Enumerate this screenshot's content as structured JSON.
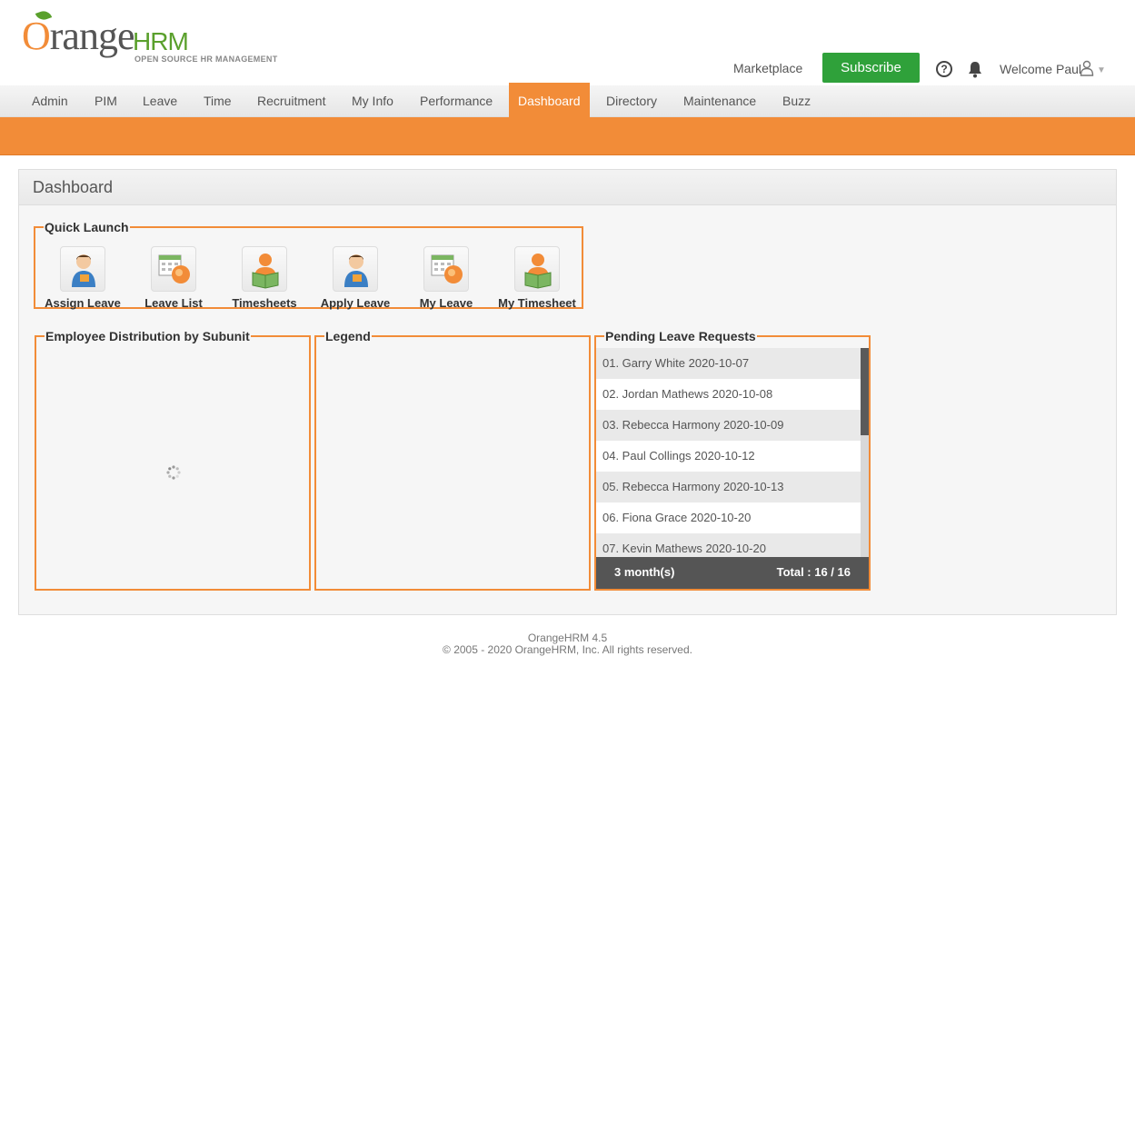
{
  "brand": {
    "logo_word": "Orange",
    "logo_hrm": "HRM",
    "tagline": "OPEN SOURCE HR MANAGEMENT"
  },
  "header": {
    "marketplace": "Marketplace",
    "subscribe": "Subscribe",
    "help_glyph": "?",
    "welcome": "Welcome Paul",
    "icons": [
      "help-icon",
      "bell-icon",
      "user-icon",
      "caret-down-icon"
    ]
  },
  "menu": {
    "items": [
      "Admin",
      "PIM",
      "Leave",
      "Time",
      "Recruitment",
      "My Info",
      "Performance",
      "Dashboard",
      "Directory",
      "Maintenance",
      "Buzz"
    ],
    "active": "Dashboard"
  },
  "dashboard": {
    "title": "Dashboard",
    "quick_launch": {
      "legend": "Quick Launch",
      "items": [
        {
          "label": "Assign Leave",
          "icon": "assign-leave-icon"
        },
        {
          "label": "Leave List",
          "icon": "leave-list-icon"
        },
        {
          "label": "Timesheets",
          "icon": "timesheets-icon"
        },
        {
          "label": "Apply Leave",
          "icon": "apply-leave-icon"
        },
        {
          "label": "My Leave",
          "icon": "my-leave-icon"
        },
        {
          "label": "My Timesheet",
          "icon": "my-timesheet-icon"
        }
      ]
    },
    "distribution": {
      "legend": "Employee Distribution by Subunit"
    },
    "legend_box": {
      "legend": "Legend"
    },
    "pending": {
      "legend": "Pending Leave Requests",
      "items": [
        "01. Garry White 2020-10-07",
        "02. Jordan Mathews 2020-10-08",
        "03. Rebecca Harmony 2020-10-09",
        "04. Paul Collings 2020-10-12",
        "05. Rebecca Harmony 2020-10-13",
        "06. Fiona Grace 2020-10-20",
        "07. Kevin Mathews 2020-10-20"
      ],
      "period": "3 month(s)",
      "total": "Total : 16 / 16"
    }
  },
  "colors": {
    "accent": "#f28c38",
    "subscribe": "#2fa13a",
    "logo_green": "#5aa02c"
  },
  "footer": {
    "version": "OrangeHRM 4.5",
    "copyright": "© 2005 - 2020 OrangeHRM, Inc. All rights reserved."
  }
}
